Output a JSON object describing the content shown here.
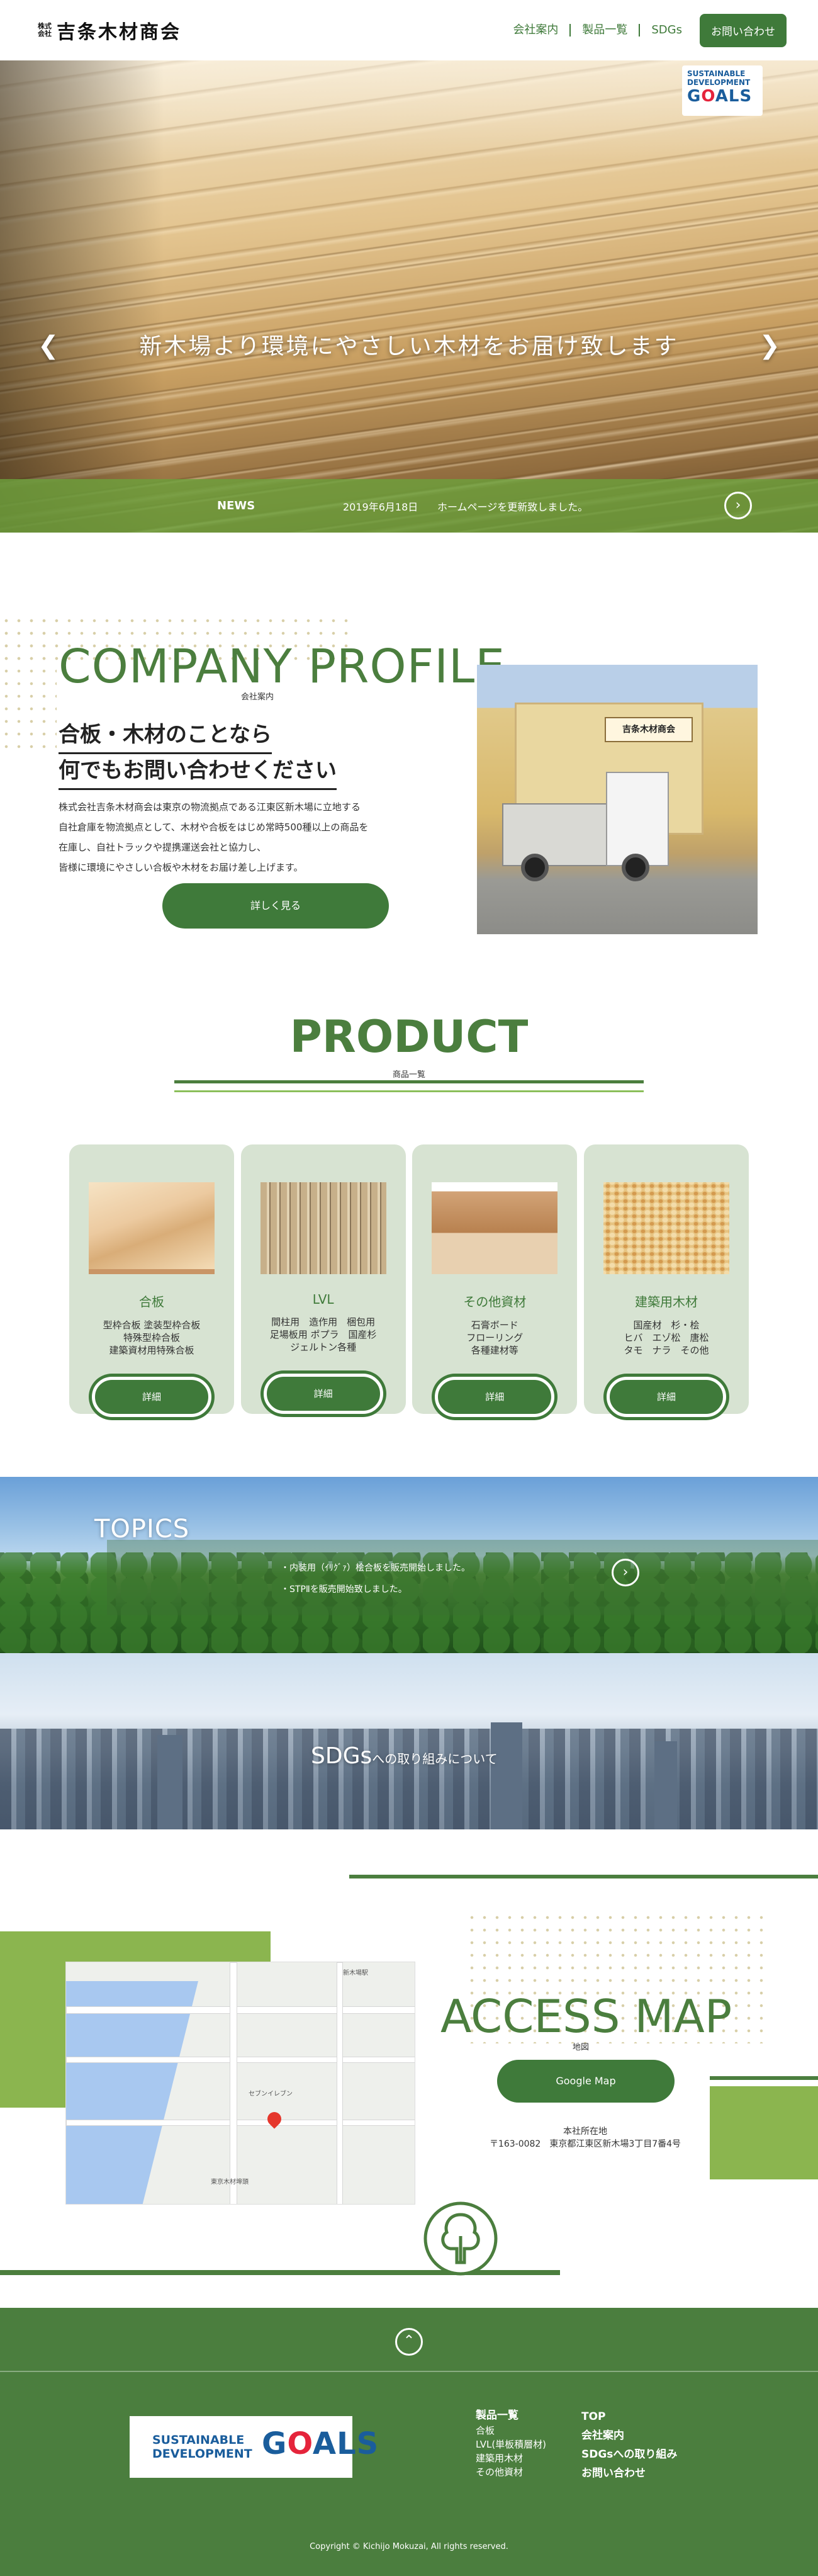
{
  "header": {
    "logo_small_1": "株式",
    "logo_small_2": "会社",
    "logo_main": "吉条木材商会",
    "nav": [
      "会社案内",
      "製品一覧",
      "SDGs"
    ],
    "contact": "お問い合わせ"
  },
  "hero": {
    "caption": "新木場より環境にやさしい木材をお届け致します",
    "sdg_line1": "SUSTAINABLE",
    "sdg_line2": "DEVELOPMENT",
    "sdg_goals_1": "G",
    "sdg_goals_o": "O",
    "sdg_goals_2": "ALS",
    "news_label": "NEWS",
    "news_date": "2019年6月18日",
    "news_text": "ホームページを更新致しました。"
  },
  "company": {
    "title": "COMPANY PROFILE",
    "subtitle": "会社案内",
    "lead_1": "合板・木材のことなら",
    "lead_2": "何でもお問い合わせください",
    "body": [
      "株式会社吉条木材商会は東京の物流拠点である江東区新木場に立地する",
      "自社倉庫を物流拠点として、木材や合板をはじめ常時500種以上の商品を",
      "在庫し、自社トラックや提携運送会社と協力し、",
      "皆様に環境にやさしい合板や木材をお届け差し上げます。"
    ],
    "button": "詳しく見る",
    "photo_sign": "吉条木材商会"
  },
  "product": {
    "title": "PRODUCT",
    "subtitle": "商品一覧",
    "cards": [
      {
        "title": "合板",
        "desc": "型枠合板 塗装型枠合板\n特殊型枠合板\n建築資材用特殊合板",
        "button": "詳細"
      },
      {
        "title": "LVL",
        "desc": "間柱用　造作用　梱包用\n足場板用 ポプラ　国産杉\nジェルトン各種",
        "button": "詳細"
      },
      {
        "title": "その他資材",
        "desc": "石膏ボード\nフローリング\n各種建材等",
        "button": "詳細"
      },
      {
        "title": "建築用木材",
        "desc": "国産材　杉・桧\nヒバ　エゾ松　唐松\nタモ　ナラ　その他",
        "button": "詳細"
      }
    ]
  },
  "topics": {
    "title": "TOPICS",
    "items": [
      "・内装用（ｲﾘｸﾞｧ）桧合板を販売開始しました。",
      "・STPⅡを販売開始致しました。"
    ]
  },
  "sdgs": {
    "label_main": "SDGs",
    "label_small": "への取り組みについて"
  },
  "access": {
    "title": "ACCESS MAP",
    "subtitle": "地図",
    "button": "Google Map",
    "addr_label": "本社所在地",
    "addr": "〒163-0082　東京都江東区新木場3丁目7番4号",
    "map_labels": [
      "新木場駅",
      "セブンイレブン",
      "東京木材埠頭"
    ]
  },
  "footer": {
    "sdg_line1": "SUSTAINABLE",
    "sdg_line2": "DEVELOPMENT",
    "sdg_goals_1": "G",
    "sdg_goals_o": "O",
    "sdg_goals_2": "ALS",
    "col1_head": "製品一覧",
    "col1_items": [
      "合板",
      "LVL(単板積層材)",
      "建築用木材",
      "その他資材"
    ],
    "col2_items": [
      "TOP",
      "会社案内",
      "SDGsへの取り組み",
      "お問い合わせ"
    ],
    "copyright": "Copyright © Kichijo Mokuzai, All rights reserved."
  },
  "colors": {
    "brand_green": "#4b7e3e",
    "light_green": "#8bb54f",
    "card_bg": "#d7e3d2"
  }
}
